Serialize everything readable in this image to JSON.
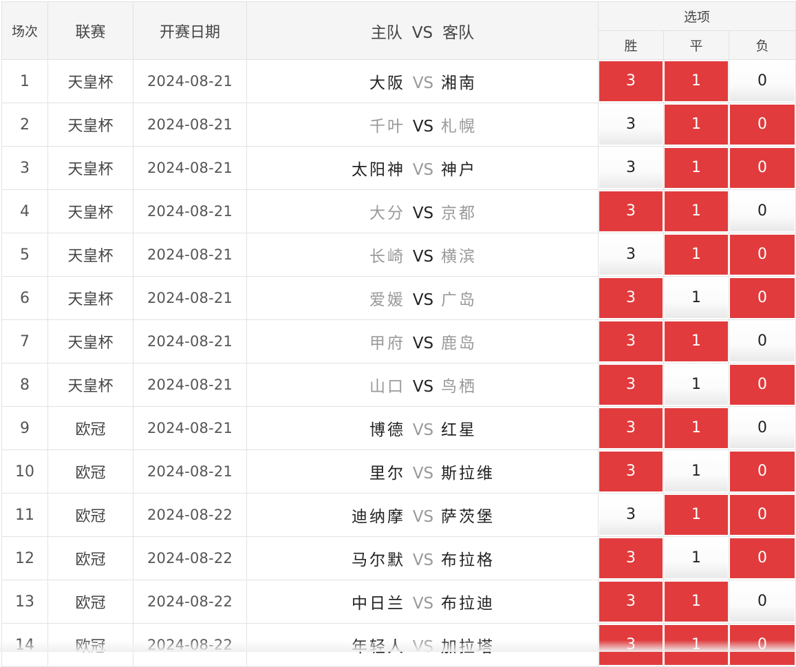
{
  "header": {
    "round": "场次",
    "league": "联赛",
    "date": "开赛日期",
    "home": "主队",
    "vs": "VS",
    "away": "客队",
    "options": "选项",
    "win": "胜",
    "draw": "平",
    "lose": "负"
  },
  "colors": {
    "selected": "#e13b3d",
    "text_dark": "#222222",
    "text_muted": "#999999",
    "border": "#e2e2e2"
  },
  "rows": [
    {
      "no": "1",
      "league": "天皇杯",
      "date": "2024-08-21",
      "home": "大阪",
      "vs": "VS",
      "away": "湘南",
      "muted": false,
      "win": "3",
      "draw": "1",
      "lose": "0",
      "sel": [
        true,
        true,
        false
      ]
    },
    {
      "no": "2",
      "league": "天皇杯",
      "date": "2024-08-21",
      "home": "千叶",
      "vs": "VS",
      "away": "札幌",
      "muted": true,
      "win": "3",
      "draw": "1",
      "lose": "0",
      "sel": [
        false,
        true,
        true
      ]
    },
    {
      "no": "3",
      "league": "天皇杯",
      "date": "2024-08-21",
      "home": "太阳神",
      "vs": "VS",
      "away": "神户",
      "muted": false,
      "win": "3",
      "draw": "1",
      "lose": "0",
      "sel": [
        false,
        true,
        true
      ]
    },
    {
      "no": "4",
      "league": "天皇杯",
      "date": "2024-08-21",
      "home": "大分",
      "vs": "VS",
      "away": "京都",
      "muted": true,
      "win": "3",
      "draw": "1",
      "lose": "0",
      "sel": [
        true,
        true,
        false
      ]
    },
    {
      "no": "5",
      "league": "天皇杯",
      "date": "2024-08-21",
      "home": "长崎",
      "vs": "VS",
      "away": "横滨",
      "muted": true,
      "win": "3",
      "draw": "1",
      "lose": "0",
      "sel": [
        false,
        true,
        true
      ]
    },
    {
      "no": "6",
      "league": "天皇杯",
      "date": "2024-08-21",
      "home": "爱媛",
      "vs": "VS",
      "away": "广岛",
      "muted": true,
      "win": "3",
      "draw": "1",
      "lose": "0",
      "sel": [
        true,
        false,
        true
      ]
    },
    {
      "no": "7",
      "league": "天皇杯",
      "date": "2024-08-21",
      "home": "甲府",
      "vs": "VS",
      "away": "鹿岛",
      "muted": true,
      "win": "3",
      "draw": "1",
      "lose": "0",
      "sel": [
        true,
        true,
        false
      ]
    },
    {
      "no": "8",
      "league": "天皇杯",
      "date": "2024-08-21",
      "home": "山口",
      "vs": "VS",
      "away": "鸟栖",
      "muted": true,
      "win": "3",
      "draw": "1",
      "lose": "0",
      "sel": [
        true,
        false,
        true
      ]
    },
    {
      "no": "9",
      "league": "欧冠",
      "date": "2024-08-21",
      "home": "博德",
      "vs": "VS",
      "away": "红星",
      "muted": false,
      "win": "3",
      "draw": "1",
      "lose": "0",
      "sel": [
        true,
        true,
        false
      ]
    },
    {
      "no": "10",
      "league": "欧冠",
      "date": "2024-08-21",
      "home": "里尔",
      "vs": "VS",
      "away": "斯拉维",
      "muted": false,
      "win": "3",
      "draw": "1",
      "lose": "0",
      "sel": [
        true,
        false,
        true
      ]
    },
    {
      "no": "11",
      "league": "欧冠",
      "date": "2024-08-22",
      "home": "迪纳摩",
      "vs": "VS",
      "away": "萨茨堡",
      "muted": false,
      "win": "3",
      "draw": "1",
      "lose": "0",
      "sel": [
        false,
        true,
        true
      ]
    },
    {
      "no": "12",
      "league": "欧冠",
      "date": "2024-08-22",
      "home": "马尔默",
      "vs": "VS",
      "away": "布拉格",
      "muted": false,
      "win": "3",
      "draw": "1",
      "lose": "0",
      "sel": [
        true,
        false,
        true
      ]
    },
    {
      "no": "13",
      "league": "欧冠",
      "date": "2024-08-22",
      "home": "中日兰",
      "vs": "VS",
      "away": "布拉迪",
      "muted": false,
      "win": "3",
      "draw": "1",
      "lose": "0",
      "sel": [
        true,
        true,
        false
      ]
    },
    {
      "no": "14",
      "league": "欧冠",
      "date": "2024-08-22",
      "home": "年轻人",
      "vs": "VS",
      "away": "加拉塔",
      "muted": false,
      "win": "3",
      "draw": "1",
      "lose": "0",
      "sel": [
        true,
        true,
        true
      ]
    }
  ]
}
